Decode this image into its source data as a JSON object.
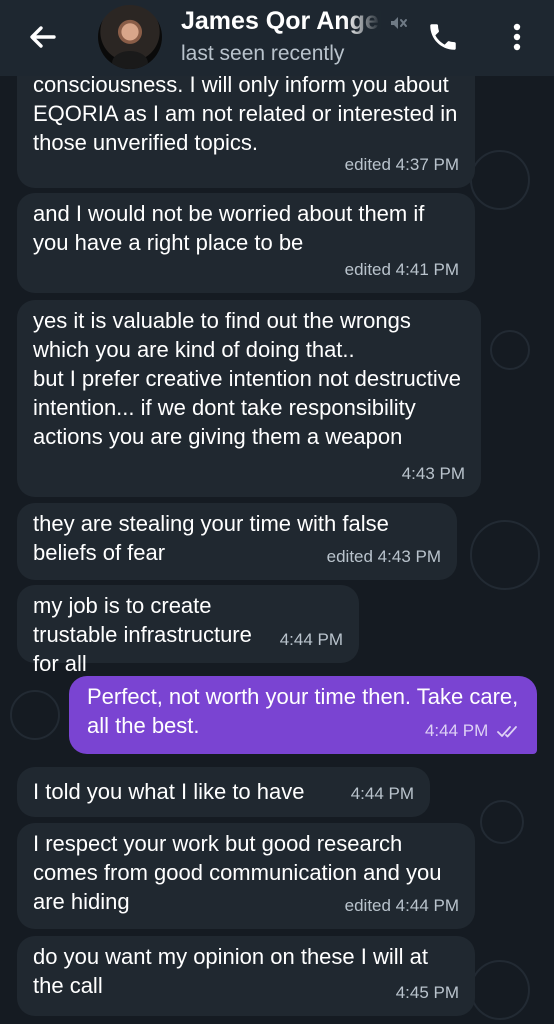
{
  "header": {
    "title": "James Qor Angel",
    "status": "last seen recently"
  },
  "messages": [
    {
      "text": "consciousness. I will only inform you about EQORIA as I am not related or interested in those unverified topics.",
      "time": "edited 4:37 PM",
      "outgoing": false
    },
    {
      "text": "and I would not be worried about them if you have a right place to be",
      "time": "edited 4:41 PM",
      "outgoing": false
    },
    {
      "text": "yes it is valuable to find out the wrongs which you are kind of doing that..\nbut I prefer creative intention not destructive intention... if we dont take responsibility actions you are giving them a weapon",
      "time": "4:43 PM",
      "outgoing": false
    },
    {
      "text": "they are stealing your time with false beliefs of fear",
      "time": "edited 4:43 PM",
      "outgoing": false
    },
    {
      "text": "my job is to create trustable infrastructure for all",
      "time": "4:44 PM",
      "outgoing": false
    },
    {
      "text": "Perfect, not worth your time then.  Take care, all the best.",
      "time": "4:44 PM",
      "outgoing": true
    },
    {
      "text": "I told you what I like to have",
      "time": "4:44 PM",
      "outgoing": false
    },
    {
      "text": "I respect your work but good research comes from good communication and you are hiding",
      "time": "edited 4:44 PM",
      "outgoing": false
    },
    {
      "text": "do you want my opinion on these I will at the call",
      "time": "4:45 PM",
      "outgoing": false
    }
  ],
  "colors": {
    "background": "#151b22",
    "header": "#1e2730",
    "incoming_bubble": "#202830",
    "outgoing_bubble": "#7a44d2"
  },
  "icons": [
    "back-arrow-icon",
    "muted-icon",
    "phone-icon",
    "more-vert-icon",
    "double-check-icon"
  ]
}
